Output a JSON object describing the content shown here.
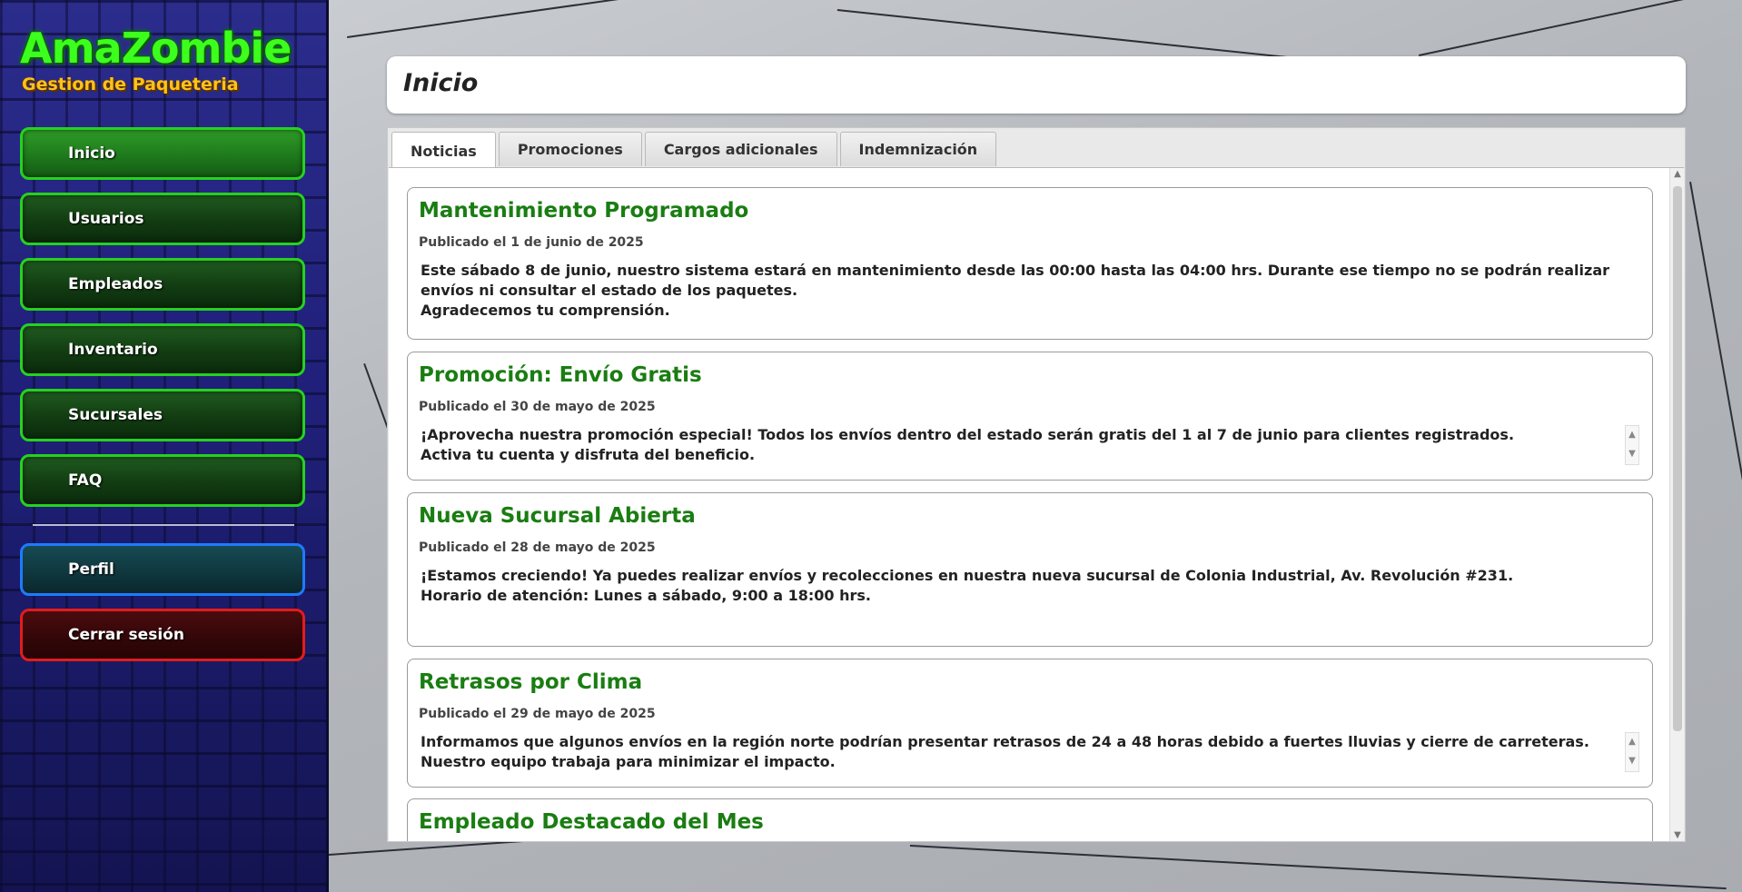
{
  "app": {
    "logo": "AmaZombie",
    "subtitle": "Gestion de Paqueteria"
  },
  "sidebar": {
    "items": [
      {
        "label": "Inicio"
      },
      {
        "label": "Usuarios"
      },
      {
        "label": "Empleados"
      },
      {
        "label": "Inventario"
      },
      {
        "label": "Sucursales"
      },
      {
        "label": "FAQ"
      }
    ],
    "profile_label": "Perfil",
    "logout_label": "Cerrar sesión"
  },
  "header": {
    "title": "Inicio"
  },
  "tabs": [
    {
      "label": "Noticias"
    },
    {
      "label": "Promociones"
    },
    {
      "label": "Cargos adicionales"
    },
    {
      "label": "Indemnización"
    }
  ],
  "news": [
    {
      "title": "Mantenimiento Programado",
      "date": "Publicado el 1 de junio de 2025",
      "body": "Este sábado 8 de junio, nuestro sistema estará en mantenimiento desde las 00:00 hasta las 04:00 hrs. Durante ese tiempo no se podrán realizar envíos ni consultar el estado de los paquetes.\nAgradecemos tu comprensión."
    },
    {
      "title": "Promoción: Envío Gratis",
      "date": "Publicado el 30 de mayo de 2025",
      "body": "¡Aprovecha nuestra promoción especial! Todos los envíos dentro del estado serán gratis del 1 al 7 de junio para clientes registrados.\nActiva tu cuenta y disfruta del beneficio."
    },
    {
      "title": "Nueva Sucursal Abierta",
      "date": "Publicado el 28 de mayo de 2025",
      "body": "¡Estamos creciendo! Ya puedes realizar envíos y recolecciones en nuestra nueva sucursal de Colonia Industrial, Av. Revolución #231.\nHorario de atención: Lunes a sábado, 9:00 a 18:00 hrs."
    },
    {
      "title": "Retrasos por Clima",
      "date": "Publicado el 29 de mayo de 2025",
      "body": "Informamos que algunos envíos en la región norte podrían presentar retrasos de 24 a 48 horas debido a fuertes lluvias y cierre de carreteras.\nNuestro equipo trabaja para minimizar el impacto."
    },
    {
      "title": "Empleado Destacado del Mes",
      "date": "",
      "body": ""
    }
  ],
  "colors": {
    "nav_green_border": "#25d21e",
    "nav_blue_border": "#1e7bff",
    "nav_red_border": "#e51b1b",
    "news_title": "#1a7d12",
    "logo": "#3dff1e",
    "subtitle": "#ffc21a"
  }
}
